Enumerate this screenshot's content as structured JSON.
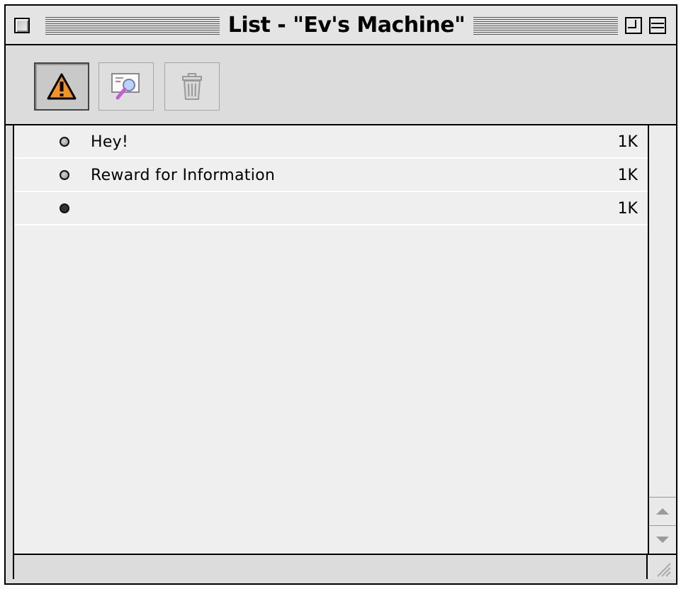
{
  "window": {
    "title": "List - \"Ev's Machine\""
  },
  "titlebar": {
    "close_icon": "close-box-icon",
    "zoom_icon": "zoom-box-icon",
    "collapse_icon": "collapse-box-icon"
  },
  "toolbar": {
    "buttons": [
      {
        "icon": "warning-icon",
        "pressed": true
      },
      {
        "icon": "view-message-icon",
        "pressed": false
      },
      {
        "icon": "trash-icon",
        "pressed": false
      }
    ]
  },
  "messages": [
    {
      "subject": "Hey!",
      "size": "1K",
      "status": "unread"
    },
    {
      "subject": "Reward for Information",
      "size": "1K",
      "status": "unread"
    },
    {
      "subject": "",
      "size": "1K",
      "status": "read"
    }
  ],
  "colors": {
    "warning": "#f7931e",
    "window_bg": "#dddddd",
    "list_bg": "#efefef"
  }
}
